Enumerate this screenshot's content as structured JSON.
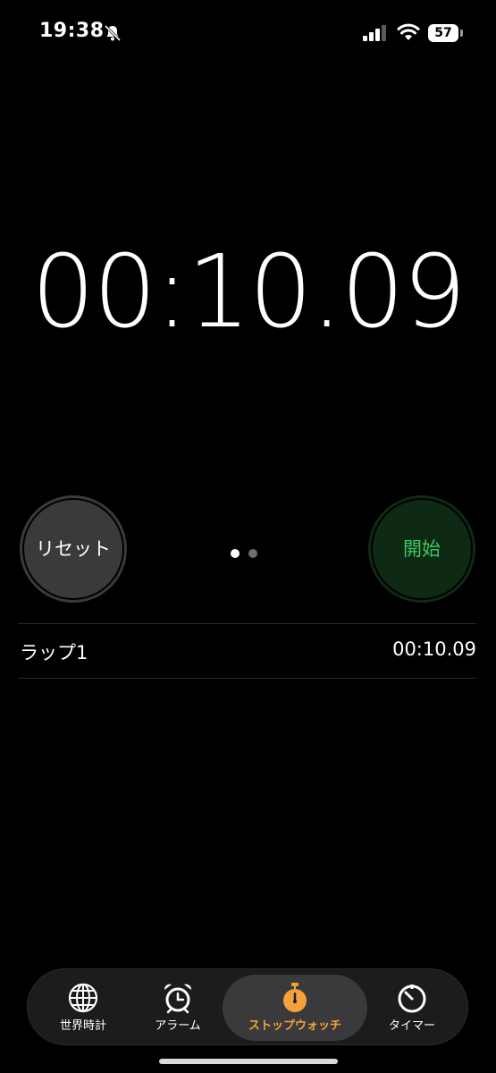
{
  "status_bar": {
    "time": "19:38",
    "battery": "57"
  },
  "stopwatch": {
    "display": "00:10.09",
    "reset_label": "リセット",
    "start_label": "開始",
    "page_dots": {
      "count": 2,
      "active_index": 0
    }
  },
  "laps": [
    {
      "name": "ラップ1",
      "time": "00:10.09"
    }
  ],
  "tabbar": {
    "items": [
      {
        "label": "世界時計",
        "icon": "globe-icon"
      },
      {
        "label": "アラーム",
        "icon": "alarm-clock-icon"
      },
      {
        "label": "ストップウォッチ",
        "icon": "stopwatch-icon",
        "selected": true
      },
      {
        "label": "タイマー",
        "icon": "timer-icon"
      }
    ]
  },
  "colors": {
    "background": "#000000",
    "start_button_bg": "#0e2a14",
    "start_button_text": "#3ec85f",
    "reset_button_bg": "#3a3a3c",
    "accent": "#f5a13a"
  }
}
